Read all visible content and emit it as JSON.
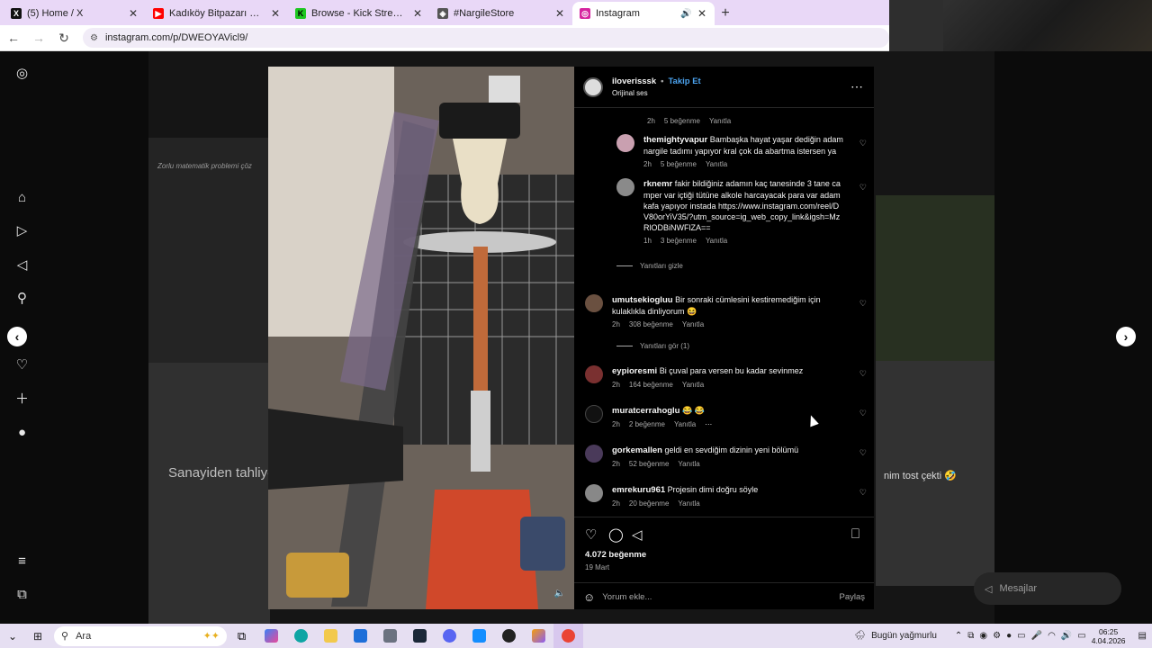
{
  "browser": {
    "tabs": [
      {
        "title": "(5) Home / X",
        "favicon": "X",
        "favcolor": "#111111"
      },
      {
        "title": "Kadıköy Bitpazarı #günceltezgâh",
        "favicon": "▶",
        "favcolor": "#ff0000"
      },
      {
        "title": "Browse - Kick Streaming",
        "favicon": "K",
        "favcolor": "#1ec721"
      },
      {
        "title": "#NargileStore",
        "favicon": "◈",
        "favcolor": "#555555"
      },
      {
        "title": "Instagram",
        "favicon": "◎",
        "favcolor": "#d6249f"
      }
    ],
    "new_tab": "+",
    "url": "instagram.com/p/DWEOYAVicl9/"
  },
  "sidebar": {
    "icons": [
      "instagram-icon",
      "home-icon",
      "reels-icon",
      "explore-icon",
      "search-icon",
      "messenger-icon",
      "notifications-icon",
      "create-icon",
      "profile-icon",
      "menu-icon",
      "meta-icon"
    ]
  },
  "background": {
    "text_left": "Sanayiden tahliye",
    "text_top": "Zorlu matematik problemi çöz",
    "text_right": "nim tost çekti 🤣"
  },
  "post": {
    "username": "iloverisssk",
    "separator": "•",
    "follow": "Takip Et",
    "audio": "Orijinal ses",
    "more": "⋯",
    "likes": "4.072 beğenme",
    "date": "19 Mart",
    "add_comment_placeholder": "Yorum ekle...",
    "share": "Paylaş"
  },
  "comments": [
    {
      "kind": "reply",
      "user": "",
      "text": "",
      "time": "2h",
      "likes": "5 beğenme",
      "reply": "Yanıtla"
    },
    {
      "kind": "reply",
      "user": "themightyvapur",
      "text": "Bambaşka hayat yaşar dediğin adam nargile tadımı yapıyor kral çok da abartma istersen ya",
      "time": "2h",
      "likes": "5 beğenme",
      "reply": "Yanıtla",
      "color": "#c9a0b0"
    },
    {
      "kind": "reply",
      "user": "rknemr",
      "text": "fakir bildiğiniz adamın kaç tanesinde 3 tane camper var içtiği tütüne alkole harcayacak para var adam kafa yapıyor instada https://www.instagram.com/reel/DV80orYiV35/?utm_source=ig_web_copy_link&igsh=MzRlODBiNWFlZA==",
      "time": "1h",
      "likes": "3 beğenme",
      "reply": "Yanıtla",
      "color": "#8a8a8a"
    },
    {
      "kind": "top",
      "user": "umutsekiogluu",
      "text": "Bir sonraki cümlesini kestiremediğim için kulaklıkla dinliyorum 😆",
      "time": "2h",
      "likes": "308 beğenme",
      "reply": "Yanıtla",
      "color": "#6a5040"
    },
    {
      "kind": "top",
      "user": "eypioresmi",
      "text": "Bi çuval para versen bu kadar sevinmez",
      "time": "2h",
      "likes": "164 beğenme",
      "reply": "Yanıtla",
      "color": "#7a3030"
    },
    {
      "kind": "top",
      "user": "muratcerrahoglu",
      "text": "😂 😂",
      "time": "2h",
      "likes": "2 beğenme",
      "reply": "Yanıtla",
      "more": "⋯",
      "color": "#111111"
    },
    {
      "kind": "top",
      "user": "gorkemallen",
      "text": "geldi en sevdiğim dizinin yeni bölümü",
      "time": "2h",
      "likes": "52 beğenme",
      "reply": "Yanıtla",
      "color": "#4a3a5a"
    },
    {
      "kind": "top",
      "user": "emrekuru961",
      "text": "Projesin dimi doğru söyle",
      "time": "2h",
      "likes": "20 beğenme",
      "reply": "Yanıtla",
      "color": "#888888"
    }
  ],
  "toggles": {
    "hide_replies": "Yanıtları gizle",
    "see_replies": "Yanıtları gör (1)"
  },
  "messages": {
    "label": "Mesajlar"
  },
  "taskbar": {
    "search": "Ara",
    "weather": "Bugün yağmurlu",
    "time": "06:25",
    "date": "4.04.2026"
  }
}
